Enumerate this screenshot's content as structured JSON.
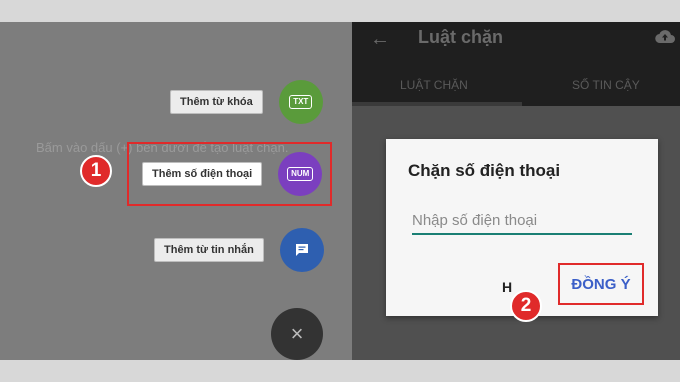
{
  "left_panel": {
    "hint": "Bấm vào dấu (+) bên dưới để tạo luật chặn.",
    "actions": [
      {
        "label": "Thêm từ khóa",
        "icon_text": "TXT",
        "color": "#5a9b3b"
      },
      {
        "label": "Thêm số điện thoại",
        "icon_text": "NUM",
        "color": "#7b3fbf"
      },
      {
        "label": "Thêm từ tin nhắn",
        "icon": "chat-icon",
        "color": "#2e5fb0"
      }
    ],
    "close_icon": "×",
    "step_badge": "1"
  },
  "right_panel": {
    "app_title": "Luật chặn",
    "back_icon": "←",
    "tabs": [
      "LUẬT CHẶN",
      "SỐ TIN CẬY"
    ],
    "dialog": {
      "title": "Chặn số điện thoại",
      "input_placeholder": "Nhập số điện thoại",
      "cancel_label": "H",
      "ok_label": "ĐỒNG Ý"
    },
    "step_badge": "2"
  },
  "colors": {
    "highlight": "#e02a2a",
    "accent_teal": "#1a7f74",
    "ok_blue": "#3b5fc8"
  }
}
